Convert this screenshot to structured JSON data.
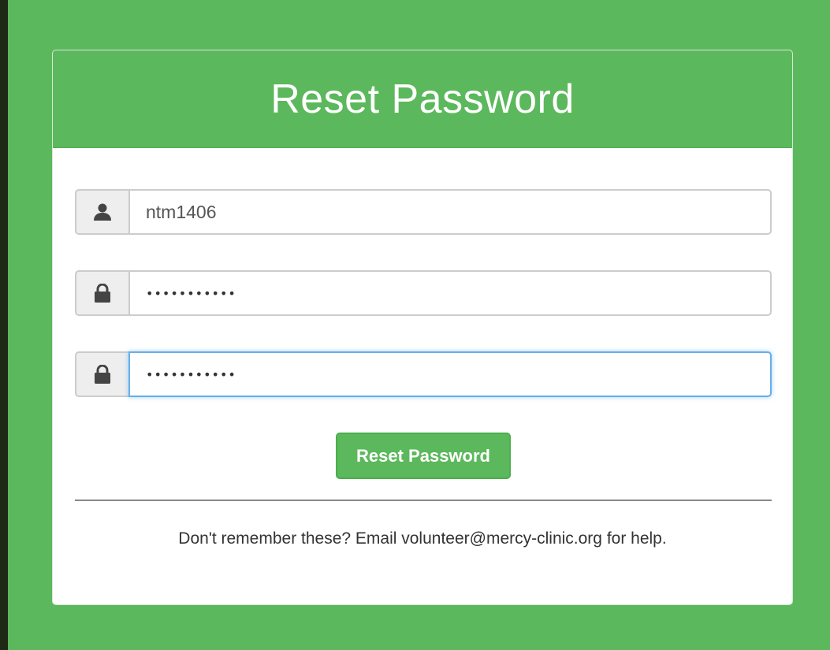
{
  "panel": {
    "title": "Reset Password"
  },
  "form": {
    "username": {
      "value": "ntm1406",
      "icon": "user-icon"
    },
    "new_password": {
      "value": "•••••••••••",
      "icon": "lock-icon"
    },
    "confirm_password": {
      "value": "•••••••••••",
      "icon": "lock-icon",
      "focused": true
    },
    "submit_label": "Reset Password"
  },
  "footer": {
    "help_text": "Don't remember these? Email volunteer@mercy-clinic.org for help."
  },
  "colors": {
    "brand_green": "#5cb85c",
    "focus_blue": "#66afe9",
    "outer_dark": "#1e2a14"
  }
}
